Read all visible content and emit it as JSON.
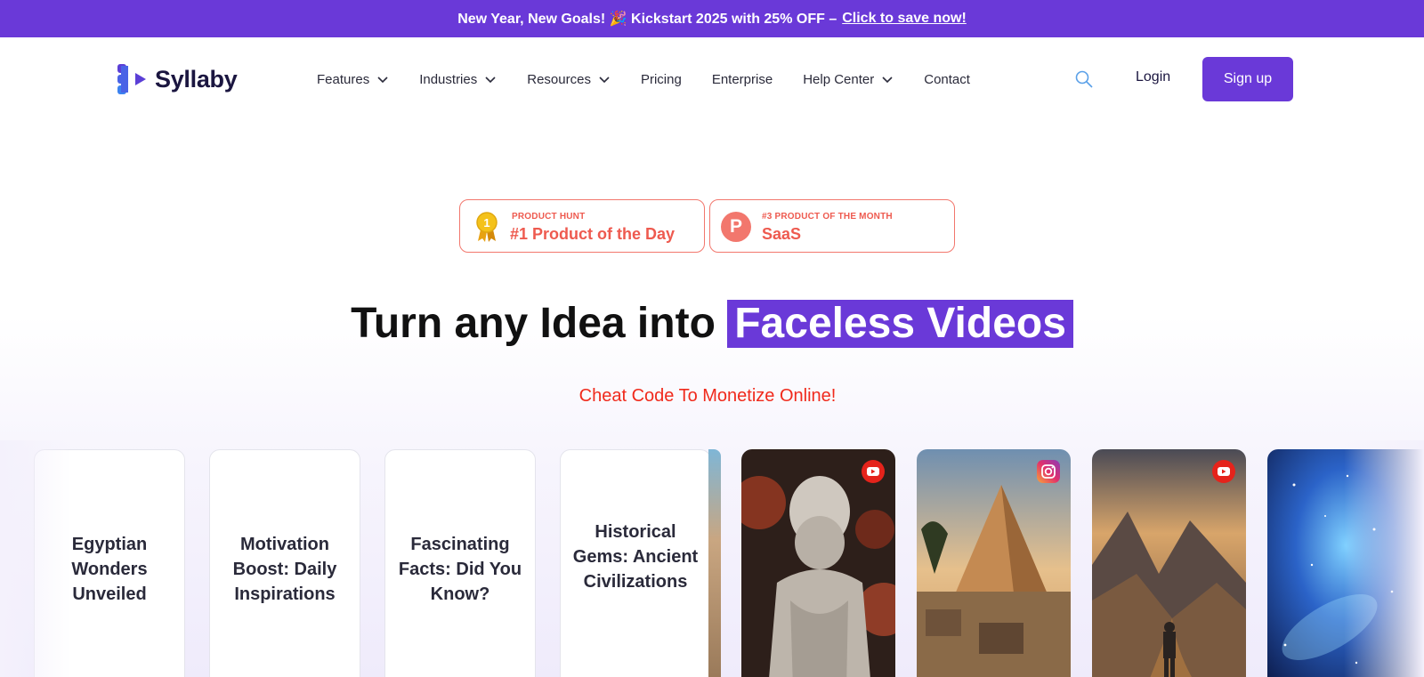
{
  "announcement": {
    "text": "New Year, New Goals! 🎉 Kickstart 2025 with 25% OFF –",
    "link": "Click to save now!"
  },
  "brand": {
    "name": "Syllaby"
  },
  "nav": {
    "items": [
      {
        "label": "Features",
        "dropdown": true
      },
      {
        "label": "Industries",
        "dropdown": true
      },
      {
        "label": "Resources",
        "dropdown": true
      },
      {
        "label": "Pricing",
        "dropdown": false
      },
      {
        "label": "Enterprise",
        "dropdown": false
      },
      {
        "label": "Help Center",
        "dropdown": true
      },
      {
        "label": "Contact",
        "dropdown": false
      }
    ],
    "login": "Login",
    "signup": "Sign up",
    "search_icon": "search-icon"
  },
  "badges": [
    {
      "small": "PRODUCT HUNT",
      "big": "#1 Product of the Day",
      "icon": "medal-icon",
      "medal_number": "1"
    },
    {
      "small": "#3 PRODUCT OF THE MONTH",
      "big": "SaaS",
      "icon": "product-hunt-icon",
      "letter": "P"
    }
  ],
  "hero": {
    "headline_plain": "Turn any Idea into",
    "headline_highlight": "Faceless Videos",
    "subheadline": "Cheat Code To Monetize Online!"
  },
  "text_cards": [
    "Egyptian Wonders Unveiled",
    "Motivation Boost: Daily Inspirations",
    "Fascinating Facts: Did You Know?",
    "Historical Gems: Ancient Civilizations"
  ],
  "image_cards": [
    {
      "subject": "stoic-statue",
      "platform": "youtube-icon"
    },
    {
      "subject": "pyramid",
      "platform": "instagram-icon"
    },
    {
      "subject": "mountain-hiker",
      "platform": "youtube-icon"
    },
    {
      "subject": "galaxy",
      "platform": ""
    }
  ],
  "colors": {
    "brand_purple": "#6a39d8",
    "badge_coral": "#ee5a4f",
    "subheadline_red": "#f02a1c",
    "logo_blue": "#3b6ff0"
  }
}
